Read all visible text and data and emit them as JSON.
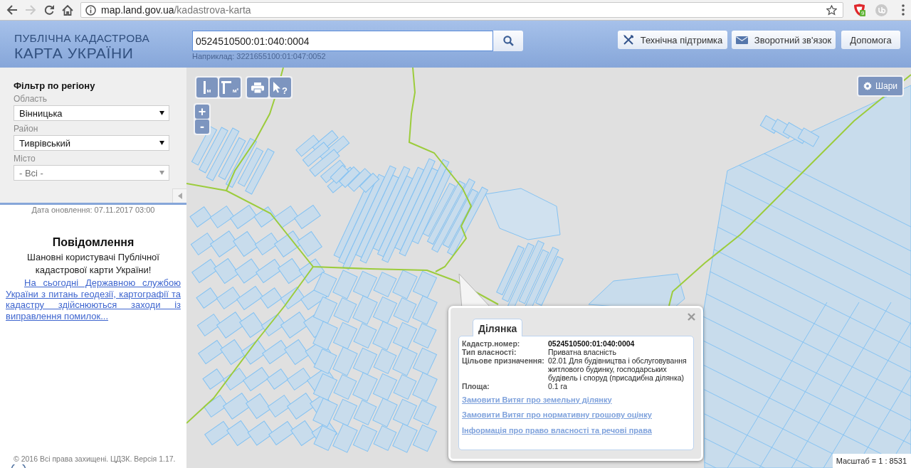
{
  "browser": {
    "nav_buttons": [
      {
        "kind": "back",
        "disabled": false
      },
      {
        "kind": "forward",
        "disabled": true
      },
      {
        "kind": "reload",
        "disabled": false
      },
      {
        "kind": "home",
        "disabled": false
      }
    ],
    "url_host": "map.land.gov.ua",
    "url_path": "/kadastrova-karta",
    "extension_badge": "9"
  },
  "header": {
    "logo": {
      "top": "ПУБЛІЧНА КАДАСТРОВА",
      "bottom": "КАРТА УКРАЇНИ"
    },
    "search": {
      "value": "0524510500:01:040:0004",
      "hint": "Наприклад: 3221655100:01:047:0052"
    },
    "buttons": [
      {
        "label": "Технічна підтримка",
        "kind": "tools"
      },
      {
        "label": "Зворотний зв'язок",
        "kind": "mail"
      },
      {
        "label": "Допомога",
        "kind": "plain"
      }
    ]
  },
  "sidebar": {
    "filter": {
      "title": "Фільтр по регіону",
      "fields": [
        {
          "label": "Область",
          "value": "Вінницька",
          "disabled": false
        },
        {
          "label": "Район",
          "value": "Тиврівський",
          "disabled": false
        },
        {
          "label": "Місто",
          "value": "- Всі -",
          "disabled": true
        }
      ]
    },
    "update_date": "Дата оновлення: 07.11.2017 03:00",
    "notice": {
      "title": "Повідомлення",
      "greeting": "Шановні користувачі Публічної кадастрової карти України!",
      "link": "На сьогодні Державною службою України з питань геодезії, картографії та кадастру здійснюються заходи із виправлення помилок..."
    },
    "footer": "© 2016 Всі права захищені. ЦДЗК. Версія 1.17."
  },
  "map": {
    "tool_groups": [
      [
        {
          "kind": "distance",
          "unit": "м"
        },
        {
          "kind": "area",
          "unit": "м²"
        }
      ],
      [
        {
          "kind": "print"
        },
        {
          "kind": "identify",
          "unit": "?"
        }
      ]
    ],
    "zoom": [
      "+",
      "-"
    ],
    "layers_button": "Шари",
    "scale": "Масштаб = 1 : 8531",
    "popup": {
      "tabs": [
        {
          "label": "Ділянка",
          "selected": true
        }
      ],
      "rows": [
        {
          "label": "Кадастр.номер:",
          "value": "0524510500:01:040:0004",
          "highlight": true
        },
        {
          "label": "Тип власності:",
          "value": "Приватна власність",
          "highlight": false
        },
        {
          "label": "Цільове призначення:",
          "value": "02.01 Для будівництва і обслуговування житлового будинку, господарських будівель і споруд (присадибна ділянка)",
          "highlight": false
        },
        {
          "label": "Площа:",
          "value": "0.1 га",
          "highlight": false
        }
      ],
      "links": [
        "Замовити Витяг про земельну ділянку",
        "Замовити Витяг про нормативну грошову оцінку",
        "Інформація про право власності та речові права"
      ]
    }
  }
}
